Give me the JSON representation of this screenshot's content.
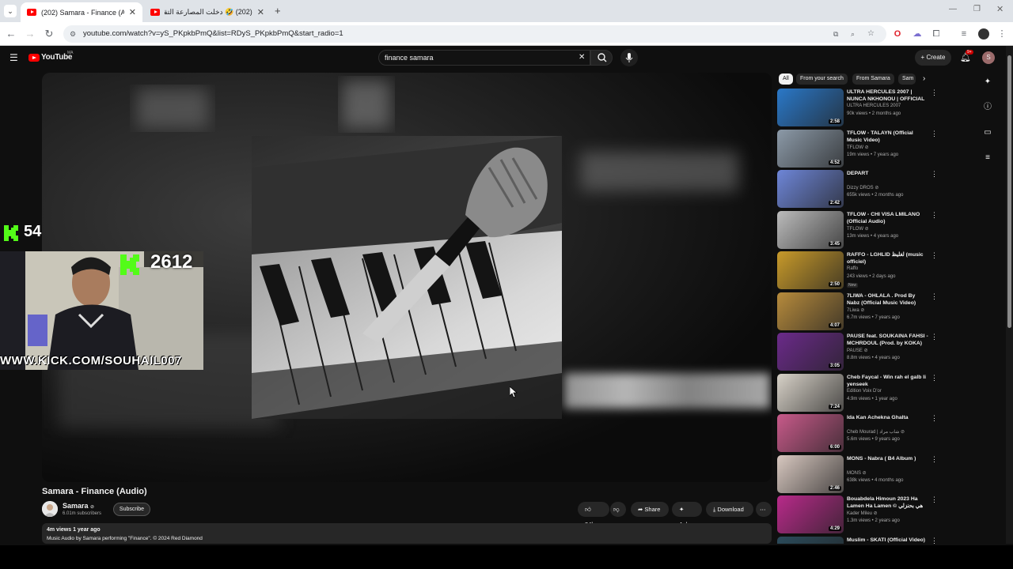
{
  "browser": {
    "tabs": [
      {
        "label": "(202) Samara - Finance (Audio)",
        "active": true
      },
      {
        "label": "(202) 🤣 دخلت المصارعة التقليد",
        "active": false
      }
    ],
    "url": "youtube.com/watch?v=yS_PKpkbPmQ&list=RDyS_PKpkbPmQ&start_radio=1",
    "new_tab": "+"
  },
  "youtube": {
    "logo_text": "YouTube",
    "logo_region": "MA",
    "search_value": "finance samara",
    "create_label": "Create",
    "notif_count": "9+",
    "avatar_letter": "S"
  },
  "overlay": {
    "viewers": "54",
    "followers": "2612",
    "kick_url": "WWW.KICK.COM/SOUHAIL007"
  },
  "video": {
    "title": "Samara - Finance (Audio)",
    "channel": "Samara",
    "subscribers": "6.01m subscribers",
    "subscribe_label": "Subscribe",
    "likes": "34k",
    "share_label": "Share",
    "ask_label": "Ask",
    "download_label": "Download",
    "views_time": "4m views  1 year ago",
    "description": "Music Audio by Samara performing \"Finance\". © 2024 Red Diamond"
  },
  "chips": [
    "All",
    "From your search",
    "From Samara",
    "Sam"
  ],
  "recommendations": [
    {
      "title": "ULTRA HERCULES 2007 | NUNCA NKHONOU | OFFICIAL ...",
      "channel": "ULTRA HERCULES 2007",
      "meta": "90k views • 2 months ago",
      "duration": "2:58",
      "thumb": "#2a78c8"
    },
    {
      "title": "TFLOW - TALAYN (Official Music Video)",
      "channel": "TFLOW ⊘",
      "meta": "19m views • 7 years ago",
      "duration": "4:52",
      "thumb": "#8c9aa8"
    },
    {
      "title": "DEPART",
      "channel": "Dizzy DROS ⊘",
      "meta": "655k views • 2 months ago",
      "duration": "2:42",
      "thumb": "#6e86d8"
    },
    {
      "title": "TFLOW - CHI VISA LMILANO (Official Audio)",
      "channel": "TFLOW ⊘",
      "meta": "13m views • 4 years ago",
      "duration": "3:45",
      "thumb": "#bcbcbc"
    },
    {
      "title": "RAFFO - LGHLID لغليظ (music officiel)",
      "channel": "Raffo",
      "meta": "243 views • 2 days ago",
      "duration": "2:50",
      "thumb": "#c89a2a",
      "badge": "New"
    },
    {
      "title": "7LIWA - OHLALA . Prod By Nabz (Official Music Video)",
      "channel": "7Liwa ⊘",
      "meta": "6.7m views • 7 years ago",
      "duration": "4:07",
      "thumb": "#b78b3c"
    },
    {
      "title": "PAUSE feat. SOUKAINA FAHSI - MCHRDOUL (Prod. by KOKA)",
      "channel": "PAUSE ⊘",
      "meta": "8.8m views • 4 years ago",
      "duration": "3:05",
      "thumb": "#6b2a8a"
    },
    {
      "title": "Cheb Faycal - Win rah el galb li yenseek",
      "channel": "Edition Voix D'or",
      "meta": "4.9m views • 1 year ago",
      "duration": "7:24",
      "thumb": "#d8d2c8"
    },
    {
      "title": "Ida Kan Achekna Ghalta",
      "channel": "Cheb Mourad | شاب مراد ⊘",
      "meta": "5.6m views • 9 years ago",
      "duration": "6:00",
      "thumb": "#c85a8a"
    },
    {
      "title": "MONS - Nabra ( B4 Album )",
      "channel": "MONS ⊘",
      "meta": "638k views • 4 months ago",
      "duration": "2:46",
      "thumb": "#d8c8c0"
    },
    {
      "title": "Bouabdela Himoun 2023 Ha Lamen Ha Lamen © هي بحنزلي",
      "channel": "Kader Mileu ⊘",
      "meta": "1.3m views • 2 years ago",
      "duration": "4:29",
      "thumb": "#b82a8a"
    },
    {
      "title": "Muslim - SKATI (Official Video)",
      "channel": "",
      "meta": "",
      "duration": "",
      "thumb": "#2a4a5a"
    }
  ]
}
